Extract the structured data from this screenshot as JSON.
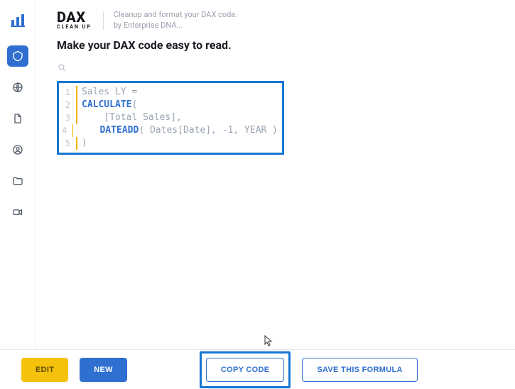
{
  "brand": {
    "name": "DAX",
    "sub": "CLEAN UP"
  },
  "tagline": {
    "line1": "Cleanup and format your DAX code.",
    "line2": "by Enterprise DNA..."
  },
  "headline": "Make your DAX code easy to read.",
  "code": {
    "lines": [
      {
        "n": "1",
        "tokens": [
          {
            "t": "Sales LY ",
            "c": "plain"
          },
          {
            "t": "=",
            "c": "plain"
          }
        ]
      },
      {
        "n": "2",
        "tokens": [
          {
            "t": "CALCULATE",
            "c": "kw"
          },
          {
            "t": "(",
            "c": "paren"
          }
        ]
      },
      {
        "n": "3",
        "tokens": [
          {
            "t": "    [Total Sales],",
            "c": "plain"
          }
        ]
      },
      {
        "n": "4",
        "tokens": [
          {
            "t": "    ",
            "c": "plain"
          },
          {
            "t": "DATEADD",
            "c": "fn"
          },
          {
            "t": "( Dates[Date], -1, YEAR )",
            "c": "plain"
          }
        ]
      },
      {
        "n": "5",
        "tokens": [
          {
            "t": ")",
            "c": "paren"
          }
        ]
      }
    ]
  },
  "buttons": {
    "edit": "EDIT",
    "new": "NEW",
    "copy": "COPY CODE",
    "save": "SAVE THIS FORMULA"
  }
}
